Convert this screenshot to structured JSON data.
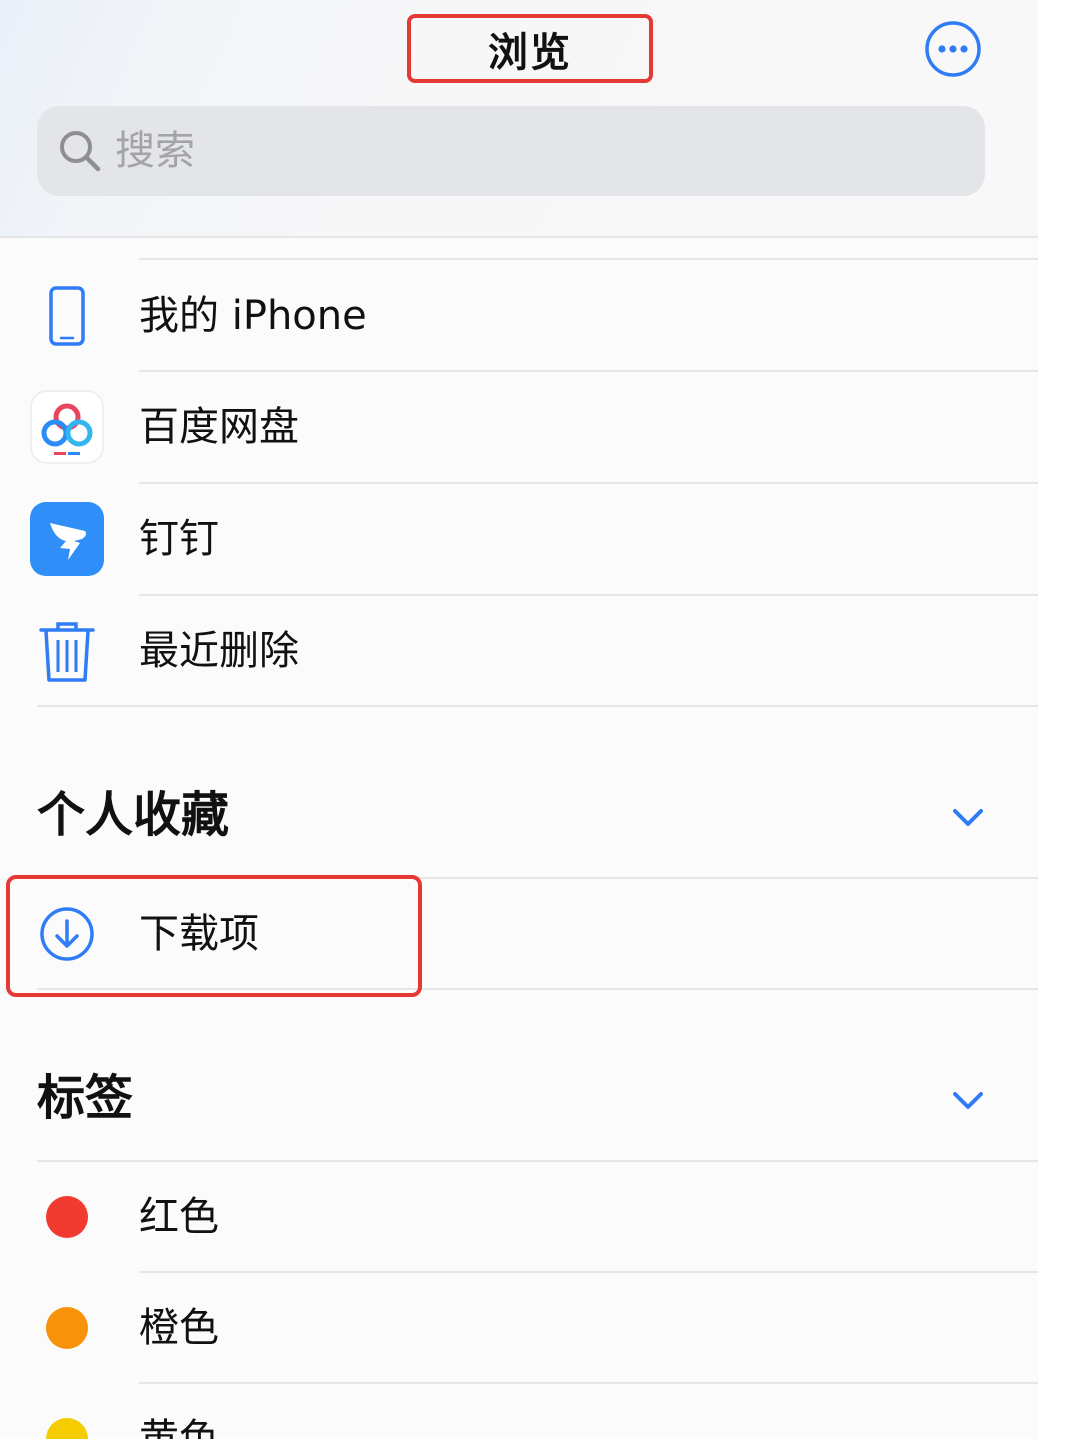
{
  "header": {
    "title": "浏览",
    "more_icon": "ellipsis-circle-icon",
    "search": {
      "placeholder": "搜索",
      "icon": "search-icon"
    }
  },
  "locations": {
    "items": [
      {
        "label": "我的 iPhone",
        "icon": "iphone-icon"
      },
      {
        "label": "百度网盘",
        "icon": "baidu-netdisk-icon"
      },
      {
        "label": "钉钉",
        "icon": "dingtalk-icon"
      },
      {
        "label": "最近删除",
        "icon": "trash-icon"
      }
    ]
  },
  "favorites": {
    "title": "个人收藏",
    "chevron_icon": "chevron-down-icon",
    "items": [
      {
        "label": "下载项",
        "icon": "download-circle-icon"
      }
    ]
  },
  "tags": {
    "title": "标签",
    "chevron_icon": "chevron-down-icon",
    "items": [
      {
        "label": "红色",
        "color": "#f23b30"
      },
      {
        "label": "橙色",
        "color": "#f7920a"
      },
      {
        "label": "黄色",
        "color": "#f5cc00"
      }
    ]
  },
  "colors": {
    "accent": "#2f7cf6",
    "highlight": "#e53935"
  }
}
